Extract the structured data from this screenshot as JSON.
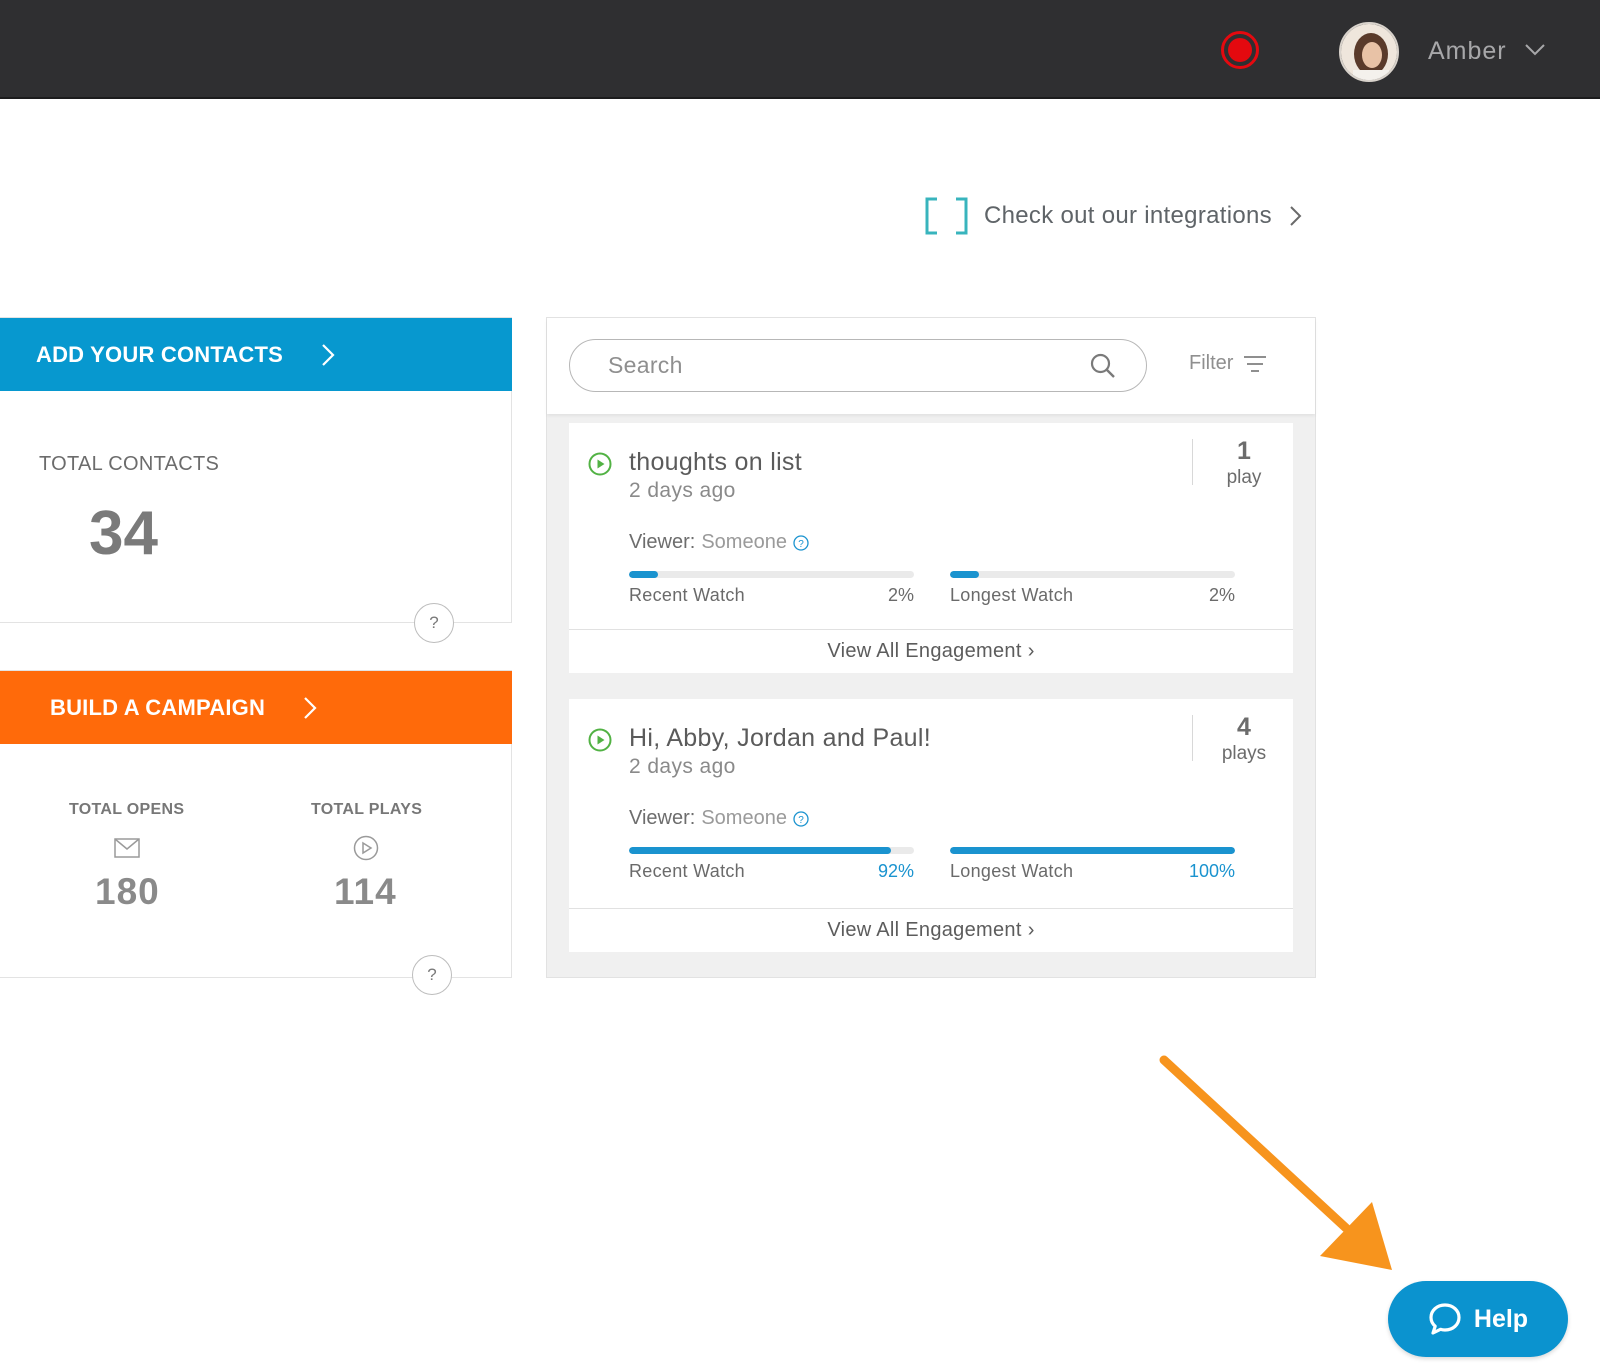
{
  "header": {
    "user_name": "Amber",
    "record_color": "#e4090f"
  },
  "integrations": {
    "label": "Check out our integrations"
  },
  "contacts_card": {
    "banner_label": "ADD YOUR CONTACTS",
    "banner_color": "#0798cf",
    "total_label": "TOTAL CONTACTS",
    "total_value": "34",
    "help": "?"
  },
  "campaign_card": {
    "banner_label": "BUILD A CAMPAIGN",
    "banner_color": "#ff6a0a",
    "opens_label": "TOTAL OPENS",
    "opens_value": "180",
    "plays_label": "TOTAL PLAYS",
    "plays_value": "114",
    "help": "?"
  },
  "search": {
    "placeholder": "Search",
    "filter_label": "Filter"
  },
  "videos": [
    {
      "title": "thoughts on list",
      "date": "2 days ago",
      "count": "1",
      "count_label": "play",
      "viewer_label": "Viewer:",
      "viewer": "Someone",
      "recent_label": "Recent Watch",
      "recent_pct": "2%",
      "recent_value": 2,
      "longest_label": "Longest Watch",
      "longest_pct": "2%",
      "longest_value": 2,
      "footer": "View All Engagement"
    },
    {
      "title": "Hi, Abby, Jordan and Paul!",
      "date": "2 days ago",
      "count": "4",
      "count_label": "plays",
      "viewer_label": "Viewer:",
      "viewer": "Someone",
      "recent_label": "Recent Watch",
      "recent_pct": "92%",
      "recent_value": 92,
      "longest_label": "Longest Watch",
      "longest_pct": "100%",
      "longest_value": 100,
      "footer": "View All Engagement"
    }
  ],
  "help_button": {
    "label": "Help",
    "color": "#0b93cf"
  },
  "annotation": {
    "arrow_color": "#f7941d"
  }
}
